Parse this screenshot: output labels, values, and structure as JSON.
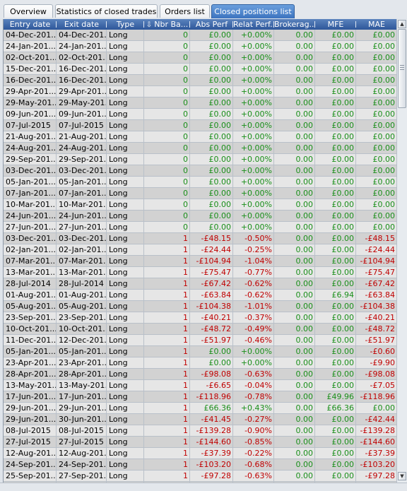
{
  "tabs": [
    {
      "label": "Overview",
      "active": false
    },
    {
      "label": "Statistics of closed trades",
      "active": false
    },
    {
      "label": "Orders list",
      "active": false
    },
    {
      "label": "Closed positions list",
      "active": true
    }
  ],
  "columns": [
    "Entry date",
    "Exit date",
    "Type",
    "Nbr Ba...",
    "Abs Perf",
    "Relat Perf...",
    "Brokerag...",
    "MFE",
    "MAE"
  ],
  "sort_icon": "sort-down-icon",
  "colors": {
    "positive": "#1a8f1a",
    "negative": "#c00000",
    "header": "#3c6aa8",
    "active_tab": "#4a82cc"
  },
  "rows": [
    [
      "04-Dec-201...",
      "04-Dec-201...",
      "Long",
      "0",
      "£0.00",
      "+0.00%",
      "0.00",
      "£0.00",
      "£0.00"
    ],
    [
      "24-Jan-201...",
      "24-Jan-201...",
      "Long",
      "0",
      "£0.00",
      "+0.00%",
      "0.00",
      "£0.00",
      "£0.00"
    ],
    [
      "02-Oct-201...",
      "02-Oct-201...",
      "Long",
      "0",
      "£0.00",
      "+0.00%",
      "0.00",
      "£0.00",
      "£0.00"
    ],
    [
      "15-Dec-201...",
      "16-Dec-201...",
      "Long",
      "0",
      "£0.00",
      "+0.00%",
      "0.00",
      "£0.00",
      "£0.00"
    ],
    [
      "16-Dec-201...",
      "16-Dec-201...",
      "Long",
      "0",
      "£0.00",
      "+0.00%",
      "0.00",
      "£0.00",
      "£0.00"
    ],
    [
      "29-Apr-201...",
      "29-Apr-201...",
      "Long",
      "0",
      "£0.00",
      "+0.00%",
      "0.00",
      "£0.00",
      "£0.00"
    ],
    [
      "29-May-201...",
      "29-May-201...",
      "Long",
      "0",
      "£0.00",
      "+0.00%",
      "0.00",
      "£0.00",
      "£0.00"
    ],
    [
      "09-Jun-201...",
      "09-Jun-201...",
      "Long",
      "0",
      "£0.00",
      "+0.00%",
      "0.00",
      "£0.00",
      "£0.00"
    ],
    [
      "07-Jul-2015",
      "07-Jul-2015",
      "Long",
      "0",
      "£0.00",
      "+0.00%",
      "0.00",
      "£0.00",
      "£0.00"
    ],
    [
      "21-Aug-201...",
      "21-Aug-201...",
      "Long",
      "0",
      "£0.00",
      "+0.00%",
      "0.00",
      "£0.00",
      "£0.00"
    ],
    [
      "24-Aug-201...",
      "24-Aug-201...",
      "Long",
      "0",
      "£0.00",
      "+0.00%",
      "0.00",
      "£0.00",
      "£0.00"
    ],
    [
      "29-Sep-201...",
      "29-Sep-201...",
      "Long",
      "0",
      "£0.00",
      "+0.00%",
      "0.00",
      "£0.00",
      "£0.00"
    ],
    [
      "03-Dec-201...",
      "03-Dec-201...",
      "Long",
      "0",
      "£0.00",
      "+0.00%",
      "0.00",
      "£0.00",
      "£0.00"
    ],
    [
      "05-Jan-201...",
      "05-Jan-201...",
      "Long",
      "0",
      "£0.00",
      "+0.00%",
      "0.00",
      "£0.00",
      "£0.00"
    ],
    [
      "07-Jan-201...",
      "07-Jan-201...",
      "Long",
      "0",
      "£0.00",
      "+0.00%",
      "0.00",
      "£0.00",
      "£0.00"
    ],
    [
      "10-Mar-201...",
      "10-Mar-201...",
      "Long",
      "0",
      "£0.00",
      "+0.00%",
      "0.00",
      "£0.00",
      "£0.00"
    ],
    [
      "24-Jun-201...",
      "24-Jun-201...",
      "Long",
      "0",
      "£0.00",
      "+0.00%",
      "0.00",
      "£0.00",
      "£0.00"
    ],
    [
      "27-Jun-201...",
      "27-Jun-201...",
      "Long",
      "0",
      "£0.00",
      "+0.00%",
      "0.00",
      "£0.00",
      "£0.00"
    ],
    [
      "03-Dec-201...",
      "03-Dec-201...",
      "Long",
      "1",
      "-£48.15",
      "-0.50%",
      "0.00",
      "£0.00",
      "-£48.15"
    ],
    [
      "02-Jan-201...",
      "02-Jan-201...",
      "Long",
      "1",
      "-£24.44",
      "-0.25%",
      "0.00",
      "£0.00",
      "-£24.44"
    ],
    [
      "07-Mar-201...",
      "07-Mar-201...",
      "Long",
      "1",
      "-£104.94",
      "-1.04%",
      "0.00",
      "£0.00",
      "-£104.94"
    ],
    [
      "13-Mar-201...",
      "13-Mar-201...",
      "Long",
      "1",
      "-£75.47",
      "-0.77%",
      "0.00",
      "£0.00",
      "-£75.47"
    ],
    [
      "28-Jul-2014",
      "28-Jul-2014",
      "Long",
      "1",
      "-£67.42",
      "-0.62%",
      "0.00",
      "£0.00",
      "-£67.42"
    ],
    [
      "01-Aug-201...",
      "01-Aug-201...",
      "Long",
      "1",
      "-£63.84",
      "-0.62%",
      "0.00",
      "£6.94",
      "-£63.84"
    ],
    [
      "05-Aug-201...",
      "05-Aug-201...",
      "Long",
      "1",
      "-£104.38",
      "-1.01%",
      "0.00",
      "£0.00",
      "-£104.38"
    ],
    [
      "23-Sep-201...",
      "23-Sep-201...",
      "Long",
      "1",
      "-£40.21",
      "-0.37%",
      "0.00",
      "£0.00",
      "-£40.21"
    ],
    [
      "10-Oct-201...",
      "10-Oct-201...",
      "Long",
      "1",
      "-£48.72",
      "-0.49%",
      "0.00",
      "£0.00",
      "-£48.72"
    ],
    [
      "11-Dec-201...",
      "12-Dec-201...",
      "Long",
      "1",
      "-£51.97",
      "-0.46%",
      "0.00",
      "£0.00",
      "-£51.97"
    ],
    [
      "05-Jan-201...",
      "05-Jan-201...",
      "Long",
      "1",
      "£0.00",
      "+0.00%",
      "0.00",
      "£0.00",
      "-£0.60"
    ],
    [
      "23-Apr-201...",
      "23-Apr-201...",
      "Long",
      "1",
      "£0.00",
      "+0.00%",
      "0.00",
      "£0.00",
      "-£9.90"
    ],
    [
      "28-Apr-201...",
      "28-Apr-201...",
      "Long",
      "1",
      "-£98.08",
      "-0.63%",
      "0.00",
      "£0.00",
      "-£98.08"
    ],
    [
      "13-May-201...",
      "13-May-201...",
      "Long",
      "1",
      "-£6.65",
      "-0.04%",
      "0.00",
      "£0.00",
      "-£7.05"
    ],
    [
      "17-Jun-201...",
      "17-Jun-201...",
      "Long",
      "1",
      "-£118.96",
      "-0.78%",
      "0.00",
      "£49.96",
      "-£118.96"
    ],
    [
      "29-Jun-201...",
      "29-Jun-201...",
      "Long",
      "1",
      "£66.36",
      "+0.43%",
      "0.00",
      "£66.36",
      "£0.00"
    ],
    [
      "29-Jun-201...",
      "30-Jun-201...",
      "Long",
      "1",
      "-£41.45",
      "-0.27%",
      "0.00",
      "£0.00",
      "-£42.44"
    ],
    [
      "08-Jul-2015",
      "08-Jul-2015",
      "Long",
      "1",
      "-£139.28",
      "-0.90%",
      "0.00",
      "£0.00",
      "-£139.28"
    ],
    [
      "27-Jul-2015",
      "27-Jul-2015",
      "Long",
      "1",
      "-£144.60",
      "-0.85%",
      "0.00",
      "£0.00",
      "-£144.60"
    ],
    [
      "12-Aug-201...",
      "12-Aug-201...",
      "Long",
      "1",
      "-£37.39",
      "-0.22%",
      "0.00",
      "£0.00",
      "-£37.39"
    ],
    [
      "24-Sep-201...",
      "24-Sep-201...",
      "Long",
      "1",
      "-£103.20",
      "-0.68%",
      "0.00",
      "£0.00",
      "-£103.20"
    ],
    [
      "25-Sep-201...",
      "27-Sep-201...",
      "Long",
      "1",
      "-£97.28",
      "-0.63%",
      "0.00",
      "£0.00",
      "-£97.28"
    ],
    [
      "",
      "",
      "",
      "",
      "",
      "",
      "",
      "",
      ""
    ]
  ]
}
